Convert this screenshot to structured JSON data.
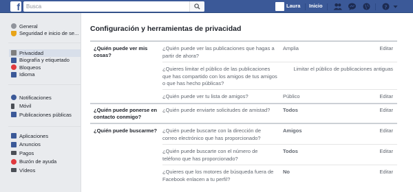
{
  "topbar": {
    "logo": "f",
    "search_placeholder": "Busca",
    "user_name": "Laura",
    "home_label": "Inicio",
    "icons": [
      "friends-icon",
      "messages-icon",
      "globe-icon",
      "help-icon",
      "caret-down-icon"
    ],
    "colors": {
      "bar": "#3b5998"
    }
  },
  "sidebar": {
    "groups": [
      [
        {
          "label": "General",
          "icon": "gear-icon",
          "color": "#90949c"
        },
        {
          "label": "Seguridad e inicio de se...",
          "icon": "shield-icon",
          "color": "#e8a419"
        }
      ],
      [
        {
          "label": "Privacidad",
          "icon": "lock-icon",
          "color": "#7f7f7f",
          "active": true
        },
        {
          "label": "Biografía y etiquetado",
          "icon": "timeline-icon",
          "color": "#3b5998"
        },
        {
          "label": "Bloqueos",
          "icon": "block-icon",
          "color": "#e0393e"
        },
        {
          "label": "Idioma",
          "icon": "language-icon",
          "color": "#3b5998"
        }
      ],
      [
        {
          "label": "Notificaciones",
          "icon": "globe-icon",
          "color": "#3b5998"
        },
        {
          "label": "Móvil",
          "icon": "mobile-icon",
          "color": "#4b4f56"
        },
        {
          "label": "Publicaciones públicas",
          "icon": "rss-icon",
          "color": "#3b5998"
        }
      ],
      [
        {
          "label": "Aplicaciones",
          "icon": "apps-icon",
          "color": "#3b5998"
        },
        {
          "label": "Anuncios",
          "icon": "ads-icon",
          "color": "#3b5998"
        },
        {
          "label": "Pagos",
          "icon": "card-icon",
          "color": "#4b4f56"
        },
        {
          "label": "Buzón de ayuda",
          "icon": "lifebuoy-icon",
          "color": "#e0393e"
        },
        {
          "label": "Vídeos",
          "icon": "video-icon",
          "color": "#4b4f56"
        }
      ]
    ]
  },
  "main": {
    "title": "Configuración y herramientas de privacidad",
    "sections": [
      {
        "label": "¿Quién puede ver mis cosas?",
        "rows": [
          {
            "question": "¿Quién puede ver las publicaciones que hagas a partir de ahora?",
            "value": "Amplia",
            "action": "Editar"
          },
          {
            "question": "¿Quieres limitar el público de las publicaciones que has compartido con los amigos de tus amigos o que has hecho públicas?",
            "value": "",
            "action": "Limitar el público de publicaciones antiguas"
          },
          {
            "question": "¿Quién puede ver tu lista de amigos?",
            "value": "Público",
            "action": "Editar"
          }
        ]
      },
      {
        "label": "¿Quién puede ponerse en contacto conmigo?",
        "rows": [
          {
            "question": "¿Quién puede enviarte solicitudes de amistad?",
            "value": "Todos",
            "action": "Editar"
          }
        ]
      },
      {
        "label": "¿Quién puede buscarme?",
        "rows": [
          {
            "question": "¿Quién puede buscarte con la dirección de correo electrónico que has proporcionado?",
            "value": "Amigos",
            "action": "Editar"
          },
          {
            "question": "¿Quién puede buscarte con el número de teléfono que has proporcionado?",
            "value": "Todos",
            "action": "Editar"
          },
          {
            "question": "¿Quieres que los motores de búsqueda fuera de Facebook enlacen a tu perfil?",
            "value": "No",
            "action": "Editar"
          }
        ]
      }
    ]
  }
}
